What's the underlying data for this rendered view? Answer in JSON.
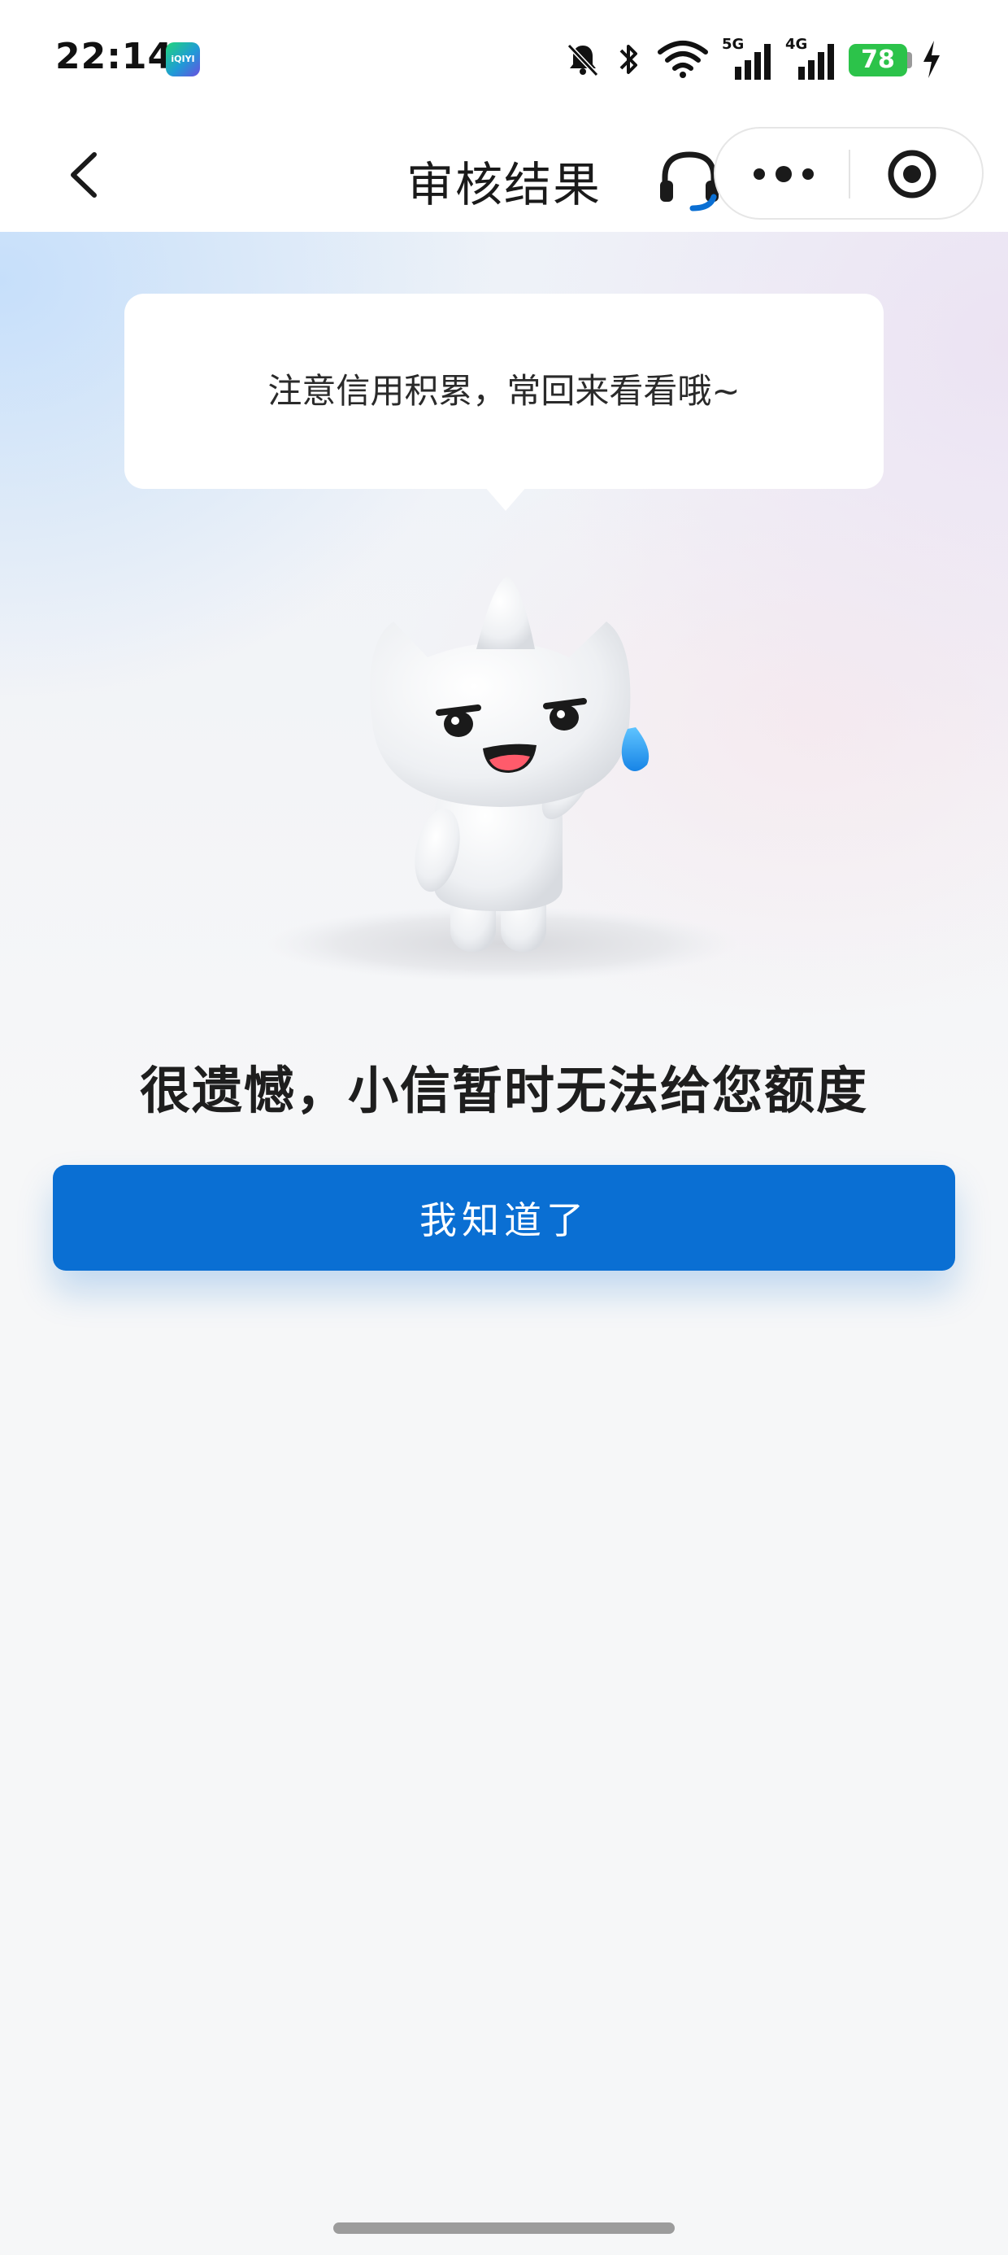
{
  "status_bar": {
    "time": "22:14",
    "app_badge": "iQIYI",
    "network_5g": "5G",
    "network_4g": "4G",
    "battery": "78",
    "icons": [
      "mute-bell-icon",
      "bluetooth-icon",
      "wifi-icon",
      "signal-5g-icon",
      "signal-4g-icon",
      "battery-icon",
      "charging-icon"
    ]
  },
  "nav": {
    "title": "审核结果",
    "icons": [
      "back-arrow-icon",
      "headset-icon",
      "more-dots-icon",
      "close-miniapp-icon"
    ]
  },
  "bubble": {
    "text": "注意信用积累，常回来看看哦~"
  },
  "result": {
    "title": "很遗憾，小信暂时无法给您额度"
  },
  "actions": {
    "confirm_label": "我知道了"
  },
  "colors": {
    "primary": "#0a6fd3",
    "battery": "#2cc34a",
    "background": "#f6f7f8"
  }
}
